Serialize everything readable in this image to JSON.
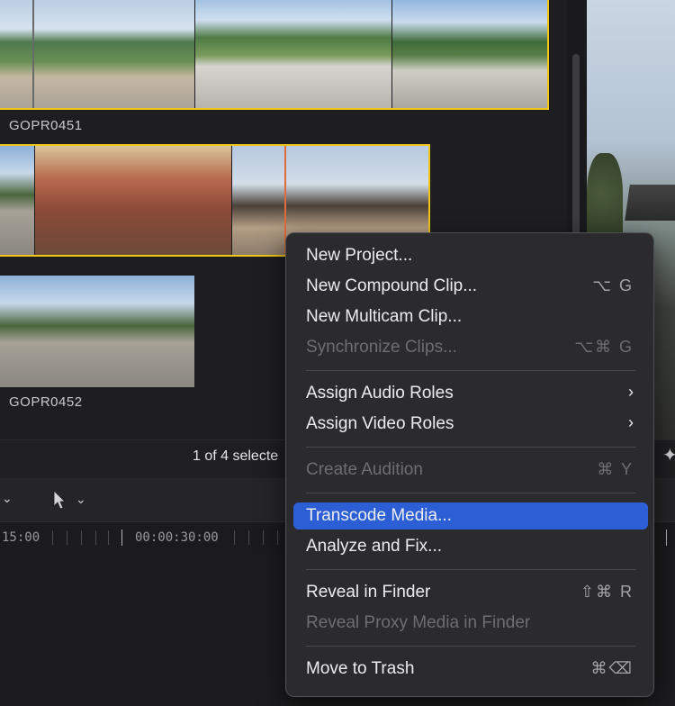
{
  "browser": {
    "clips": [
      {
        "label": ""
      },
      {
        "label": "GOPR0451"
      },
      {
        "label": ""
      },
      {
        "label": "GOPR0452"
      }
    ],
    "selection_status": "1 of 4 selecte"
  },
  "timeline": {
    "timecodes": [
      "15:00",
      "00:00:30:00"
    ]
  },
  "context_menu": {
    "items": [
      {
        "label": "New Project...",
        "shortcut": "",
        "disabled": false
      },
      {
        "label": "New Compound Clip...",
        "shortcut": "⌥ G",
        "disabled": false
      },
      {
        "label": "New Multicam Clip...",
        "shortcut": "",
        "disabled": false
      },
      {
        "label": "Synchronize Clips...",
        "shortcut": "⌥⌘ G",
        "disabled": true
      },
      {
        "label": "Assign Audio Roles",
        "shortcut": "",
        "submenu": true
      },
      {
        "label": "Assign Video Roles",
        "shortcut": "",
        "submenu": true
      },
      {
        "label": "Create Audition",
        "shortcut": "⌘ Y",
        "disabled": true
      },
      {
        "label": "Transcode Media...",
        "shortcut": "",
        "highlighted": true
      },
      {
        "label": "Analyze and Fix...",
        "shortcut": ""
      },
      {
        "label": "Reveal in Finder",
        "shortcut": "⇧⌘ R"
      },
      {
        "label": "Reveal Proxy Media in Finder",
        "shortcut": "",
        "disabled": true
      },
      {
        "label": "Move to Trash",
        "shortcut": "⌘⌫"
      }
    ]
  },
  "colors": {
    "selection_border": "#f0c419",
    "menu_highlight": "#2c5fd6",
    "playhead": "#e06b3c"
  }
}
